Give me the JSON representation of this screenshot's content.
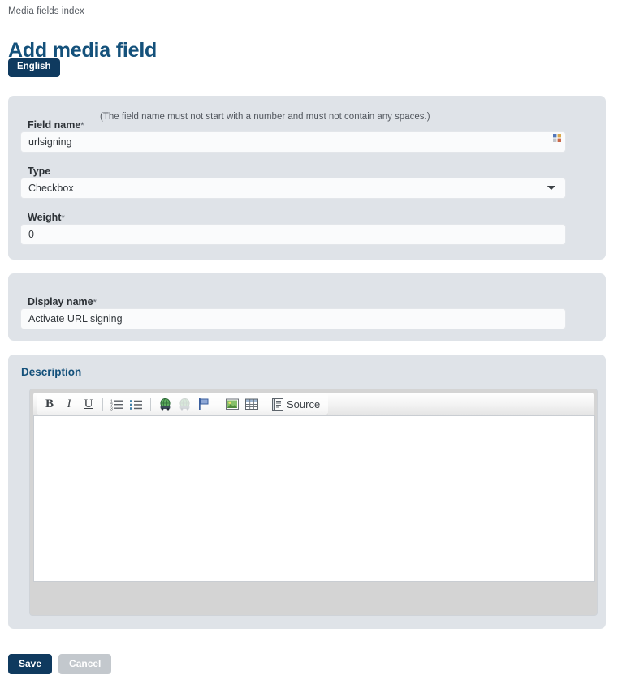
{
  "breadcrumb": "Media fields index",
  "page_title": "Add media field",
  "language_badge": "English",
  "colors": {
    "accent": "#14517b",
    "badge": "#0f3a5f",
    "panel": "#dfe3e8",
    "save": "#0f3a5f",
    "cancel": "#c3c8cd"
  },
  "basic_panel": {
    "field_name": {
      "label": "Field name",
      "required_marker": "*",
      "help": "(The field name must not start with a number and must not contain any spaces.)",
      "value": "urlsigning"
    },
    "type": {
      "label": "Type",
      "value": "Checkbox",
      "options": [
        "Checkbox"
      ]
    },
    "weight": {
      "label": "Weight",
      "required_marker": "*",
      "value": "0"
    }
  },
  "display_panel": {
    "display_name": {
      "label": "Display name",
      "required_marker": "*",
      "value": "Activate URL signing"
    }
  },
  "description_panel": {
    "title": "Description",
    "editor": {
      "content": "",
      "toolbar": [
        {
          "name": "bold-icon",
          "glyph": "B"
        },
        {
          "name": "italic-icon",
          "glyph": "I"
        },
        {
          "name": "underline-icon",
          "glyph": "U"
        },
        {
          "name": "numbered-list-icon",
          "glyph": ""
        },
        {
          "name": "bulleted-list-icon",
          "glyph": ""
        },
        {
          "name": "link-icon",
          "glyph": ""
        },
        {
          "name": "unlink-icon",
          "glyph": ""
        },
        {
          "name": "anchor-flag-icon",
          "glyph": ""
        },
        {
          "name": "image-icon",
          "glyph": ""
        },
        {
          "name": "table-icon",
          "glyph": ""
        },
        {
          "name": "source-icon",
          "glyph": ""
        }
      ],
      "source_label": "Source"
    }
  },
  "actions": {
    "save_label": "Save",
    "cancel_label": "Cancel"
  }
}
